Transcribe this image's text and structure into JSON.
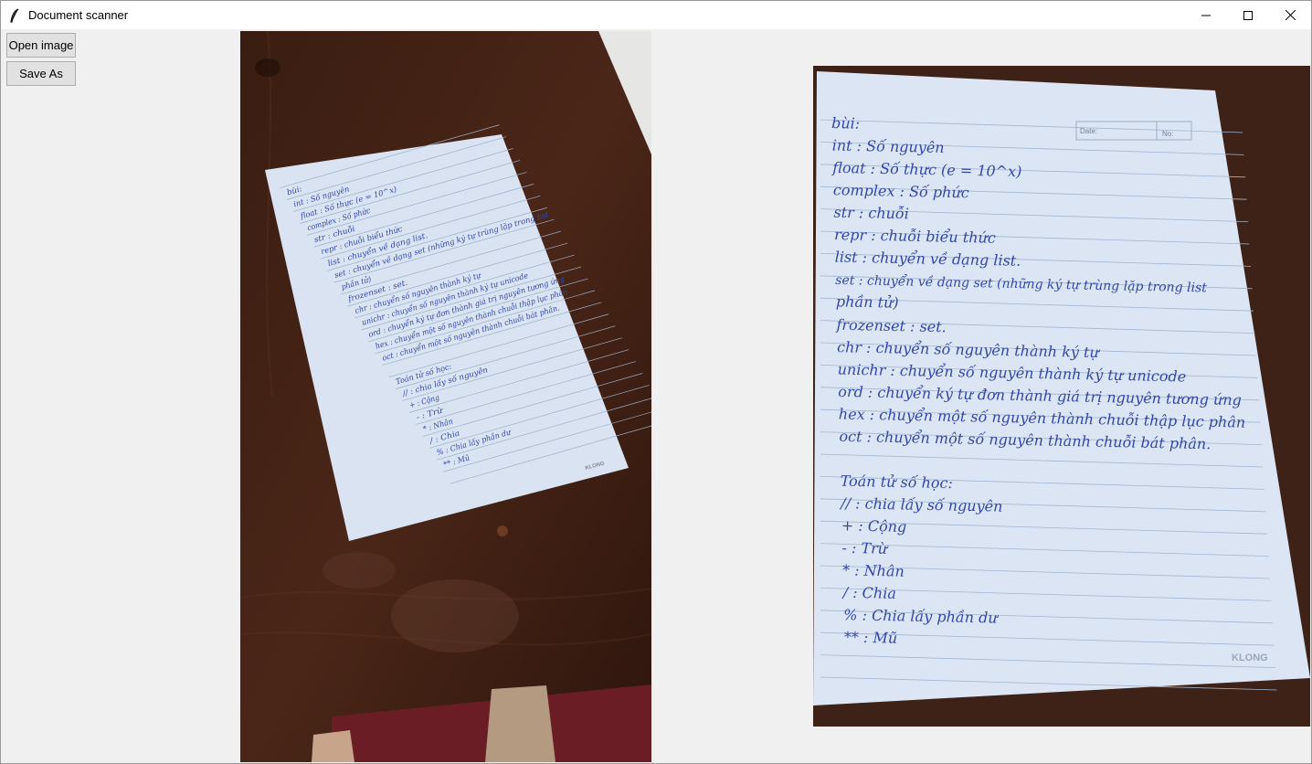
{
  "window": {
    "title": "Document scanner",
    "app_icon": "feather-icon",
    "controls": [
      "minimize-icon",
      "maximize-icon",
      "close-icon"
    ]
  },
  "sidebar": {
    "open_label": "Open image",
    "save_label": "Save As"
  },
  "notes": {
    "header": [
      "Date:",
      "No:"
    ],
    "brand": "KLONG",
    "lines": [
      "bùi:",
      "int : Số nguyên",
      "float : Số thực (e = 10^x)",
      "complex : Số phức",
      "str : chuỗi",
      "repr : chuỗi biểu thức",
      "list : chuyển về dạng list.",
      "set : chuyển về dạng set (những ký tự trùng lặp trong list",
      "phần tử)",
      "frozenset : set.",
      "chr : chuyển số nguyên thành ký tự",
      "unichr : chuyển số nguyên thành ký tự unicode",
      "ord : chuyển ký tự đơn thành giá trị nguyên tương ứng",
      "hex : chuyển một số nguyên thành chuỗi thập lục phân",
      "oct : chuyển một số nguyên thành chuỗi bát phân.",
      "",
      "Toán tử số học:",
      "// : chia lấy số nguyên",
      "+ : Cộng",
      "- : Trừ",
      "* : Nhân",
      "/ : Chia",
      "% : Chia lấy phần dư",
      "** : Mũ"
    ]
  }
}
